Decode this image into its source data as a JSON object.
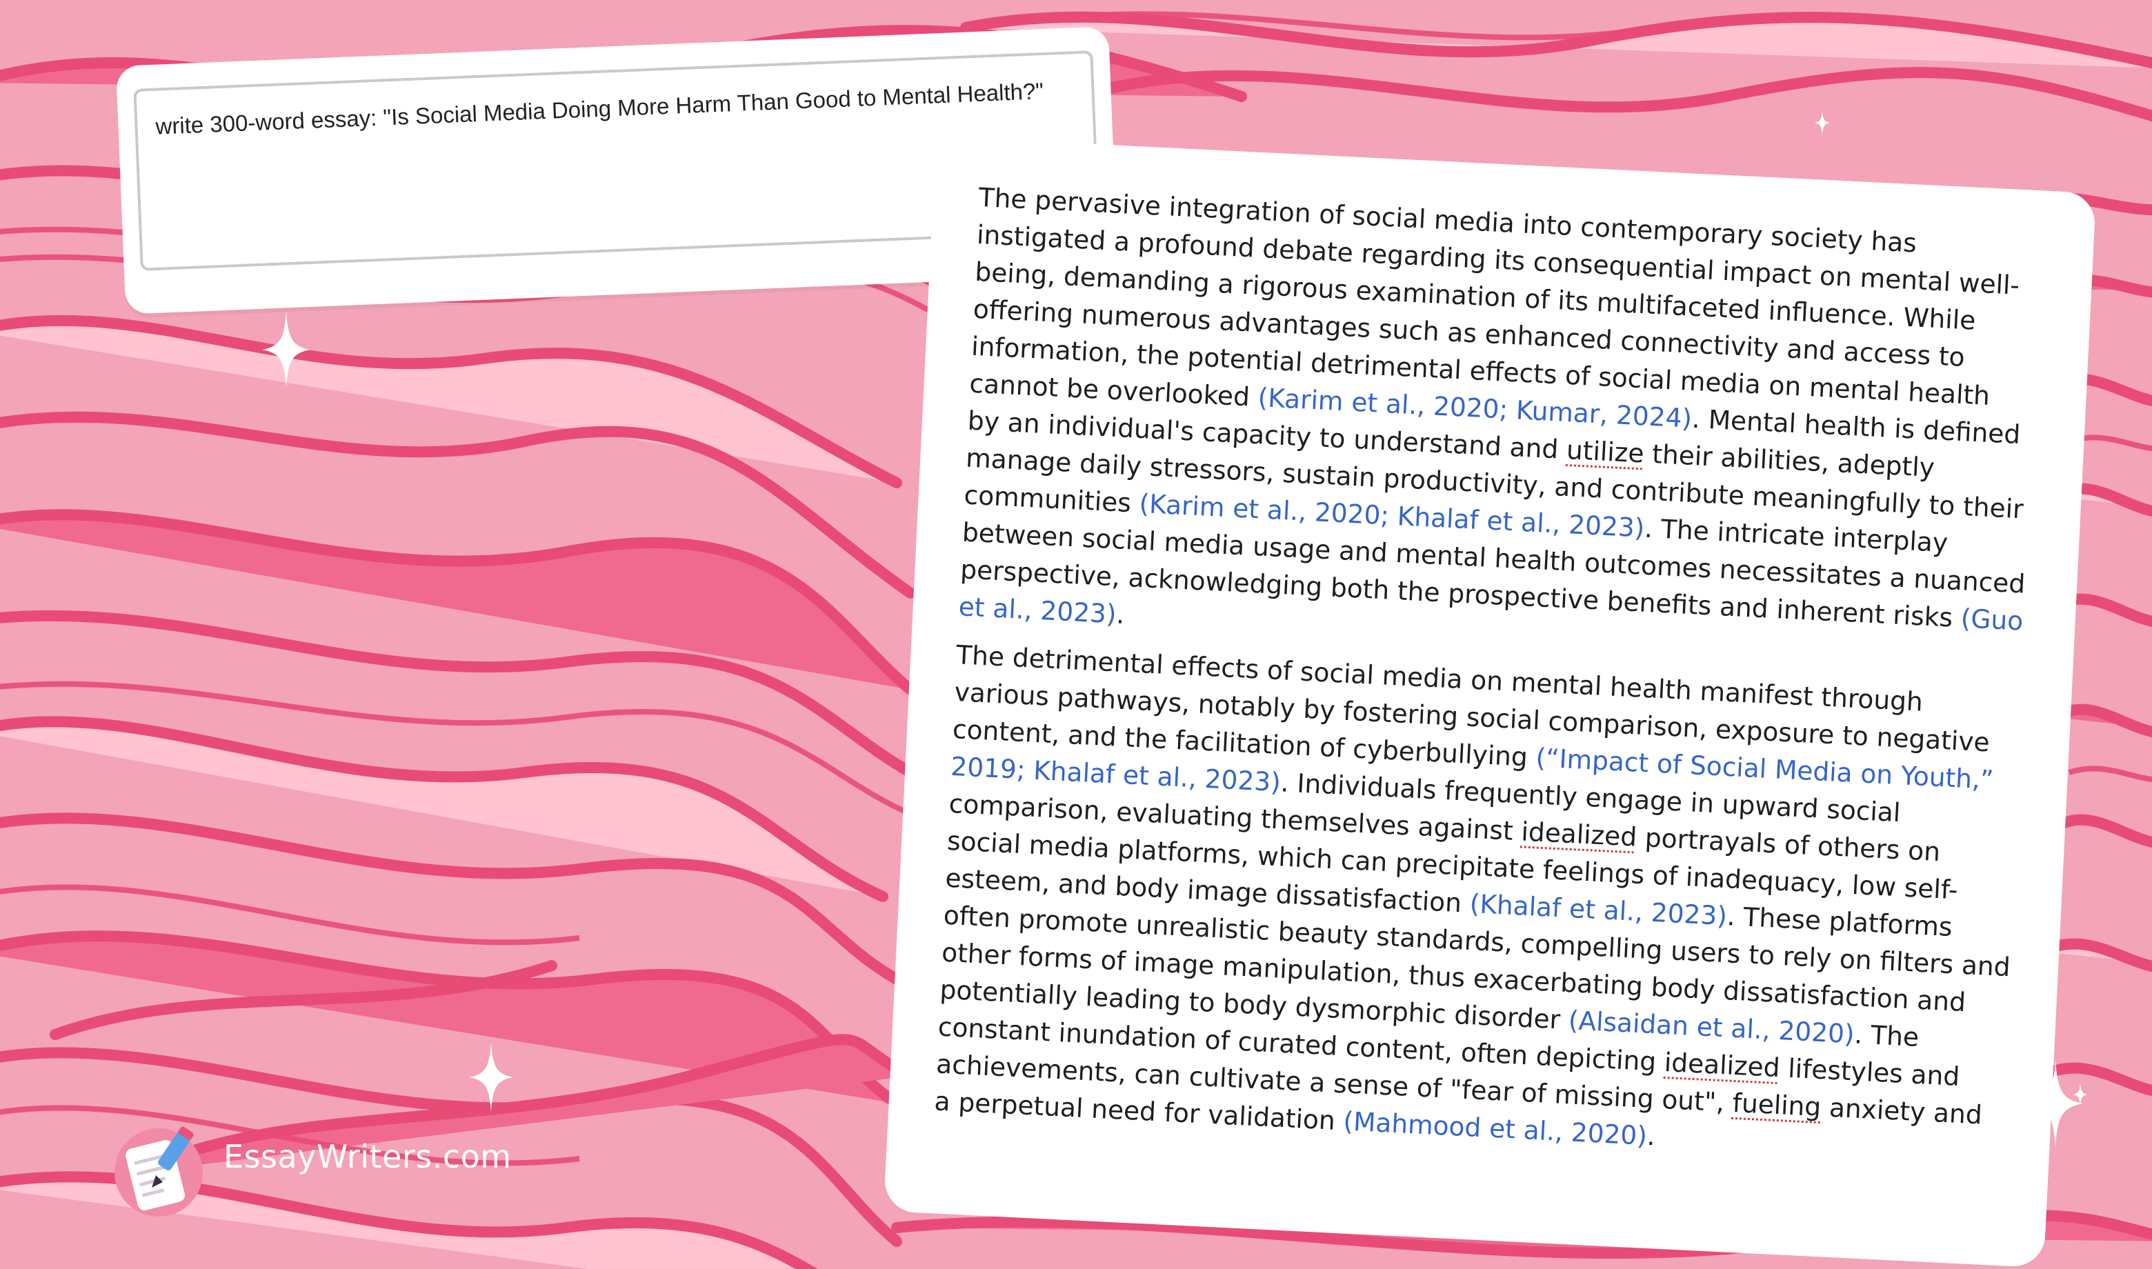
{
  "colors": {
    "background": "#f3a4b8",
    "stroke": "#e84b76",
    "band_dark": "#ef6a8e",
    "band_light": "#ffc3d2",
    "citation": "#3565c9",
    "text": "#1e1e1e"
  },
  "prompt": {
    "text": "write 300-word essay: \"Is Social Media Doing More Harm Than Good to Mental Health?\""
  },
  "response": {
    "p1": {
      "s1": "The pervasive integration of social media into contemporary society has instigated a profound debate regarding its consequential impact on mental well-being, demanding a rigorous examination of its multifaceted influence. While offering numerous advantages such as enhanced connectivity and access to information, the potential detrimental effects of social media on mental health cannot be overlooked ",
      "c1": "(Karim et al., 2020; Kumar, 2024)",
      "s2": ". Mental health is defined by an individual's capacity to understand and ",
      "w1": "utilize",
      "s3": " their abilities, adeptly manage daily stressors, sustain productivity, and contribute meaningfully to their communities ",
      "c2": "(Karim et al., 2020; Khalaf et al., 2023)",
      "s4": ". The intricate interplay between social media usage and mental health outcomes necessitates a nuanced perspective, acknowledging both the prospective benefits and inherent risks ",
      "c3": "(Guo et al., 2023)",
      "s5": "."
    },
    "p2": {
      "s1": "The detrimental effects of social media on mental health manifest through various pathways, notably by fostering social comparison, exposure to negative content, and the facilitation of cyberbullying ",
      "c1": "(“Impact of Social Media on Youth,” 2019; Khalaf et al., 2023)",
      "s2": ". Individuals frequently engage in upward social comparison, evaluating themselves against ",
      "w1": "idealized",
      "s3": " portrayals of others on social media platforms, which can precipitate feelings of inadequacy, low self-esteem, and body image dissatisfaction ",
      "c2": "(Khalaf et al., 2023)",
      "s4": ". These platforms often promote unrealistic beauty standards, compelling users to rely on filters and other forms of image manipulation, thus exacerbating body dissatisfaction and potentially leading to body dysmorphic disorder ",
      "c3": "(Alsaidan et al., 2020)",
      "s5": ". The constant inundation of curated content, often depicting ",
      "w2": "idealized",
      "s6": " lifestyles and achievements, can cultivate a sense of \"fear of missing out\", ",
      "w3": "fueling",
      "s7": " anxiety and a perpetual need for validation ",
      "c4": "(Mahmood et al., 2020)",
      "s8": "."
    }
  },
  "brand": {
    "name": "EssayWriters.com",
    "logo_icon": "paper-pencil-logo-icon"
  }
}
